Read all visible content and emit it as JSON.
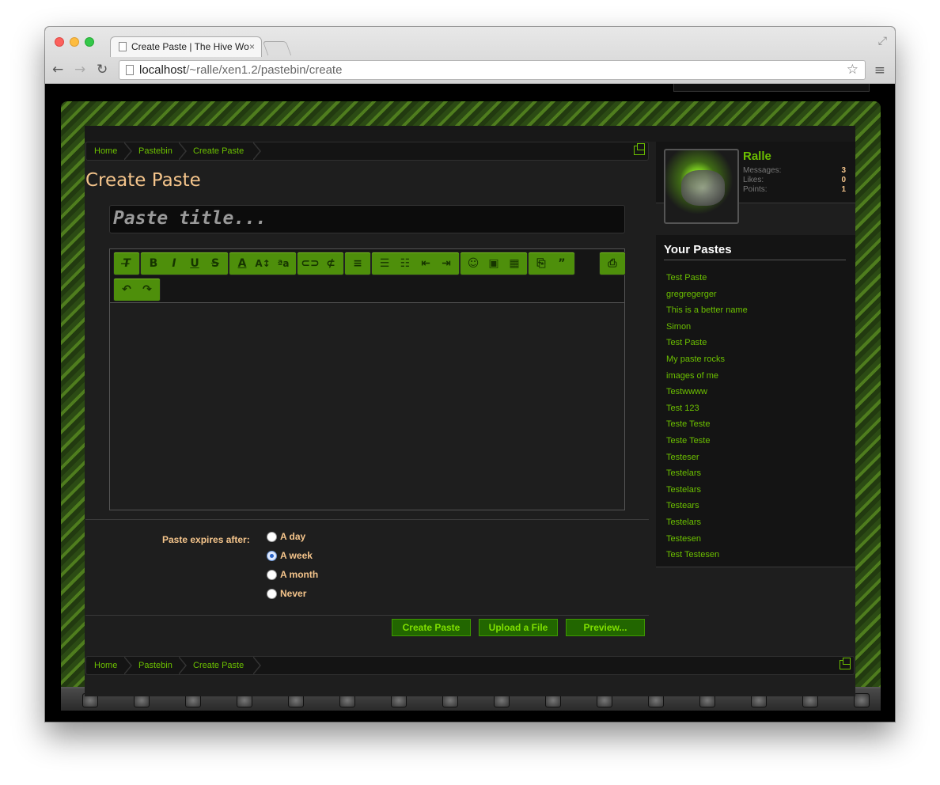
{
  "browser": {
    "tab_title": "Create Paste | The Hive Wo",
    "tab_close": "×",
    "url_host": "localhost",
    "url_path": "/~ralle/xen1.2/pastebin/create"
  },
  "breadcrumbs": [
    "Home",
    "Pastebin",
    "Create Paste"
  ],
  "page_title": "Create Paste",
  "paste_title_placeholder": "Paste title...",
  "toolbar_icons": [
    [
      "remove-format-icon",
      "bold-icon",
      "italic-icon",
      "underline-icon",
      "strikethrough-icon"
    ],
    [
      "font-color-icon",
      "font-size-icon",
      "font-family-icon"
    ],
    [
      "link-icon",
      "unlink-icon"
    ],
    [
      "align-icon"
    ],
    [
      "bullet-list-icon",
      "numbered-list-icon",
      "outdent-icon",
      "indent-icon"
    ],
    [
      "smilie-icon",
      "image-icon",
      "media-icon"
    ],
    [
      "code-icon",
      "quote-icon"
    ],
    [
      "source-toggle-icon"
    ],
    [
      "undo-icon",
      "redo-icon"
    ]
  ],
  "expiry": {
    "label": "Paste expires after:",
    "options": [
      "A day",
      "A week",
      "A month",
      "Never"
    ],
    "selected": "A week"
  },
  "buttons": {
    "create": "Create Paste",
    "upload": "Upload a File",
    "preview": "Preview..."
  },
  "user": {
    "name": "Ralle",
    "stats": [
      {
        "label": "Messages:",
        "value": "3"
      },
      {
        "label": "Likes:",
        "value": "0"
      },
      {
        "label": "Points:",
        "value": "1"
      }
    ]
  },
  "your_pastes": {
    "heading": "Your Pastes",
    "items": [
      "Test Paste",
      "gregregerger",
      "This is a better name",
      "Simon",
      "Test Paste",
      "My paste rocks",
      "images of me",
      "Testwwww",
      "Test 123",
      "Teste Teste",
      "Teste Teste",
      "Testeser",
      "Testelars",
      "Testelars",
      "Testears",
      "Testelars",
      "Testesen",
      "Test Testesen"
    ]
  },
  "colors": {
    "accent_green": "#6cc000",
    "title_peach": "#f4c48b",
    "toolbar_green": "#4e8f0b",
    "page_bg": "#1e1e1e"
  }
}
